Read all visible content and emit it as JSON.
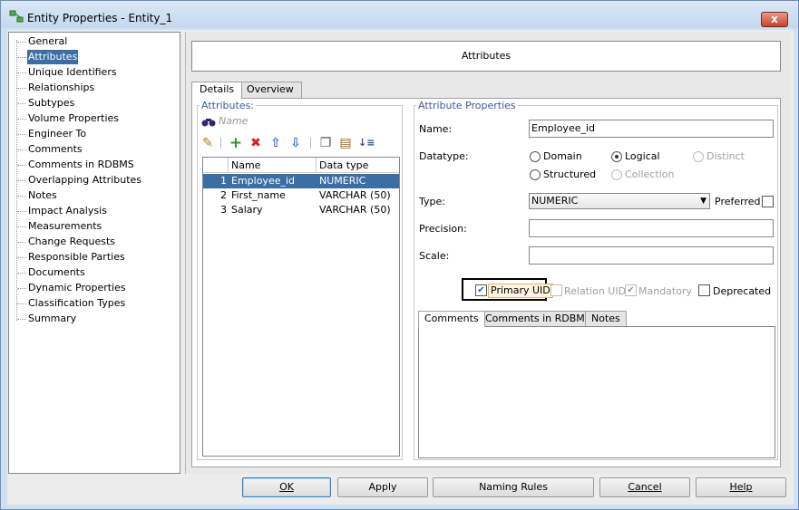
{
  "window": {
    "title": "Entity Properties - Entity_1",
    "close_label": "x"
  },
  "nav": {
    "items": [
      "General",
      "Attributes",
      "Unique Identifiers",
      "Relationships",
      "Subtypes",
      "Volume Properties",
      "Engineer To",
      "Comments",
      "Comments in RDBMS",
      "Overlapping Attributes",
      "Notes",
      "Impact Analysis",
      "Measurements",
      "Change Requests",
      "Responsible Parties",
      "Documents",
      "Dynamic Properties",
      "Classification Types",
      "Summary"
    ],
    "selected": "Attributes"
  },
  "header": {
    "title": "Attributes"
  },
  "tabs": [
    "Details",
    "Overview"
  ],
  "attributes": {
    "label": "Attributes:",
    "search_placeholder": "Name",
    "columns": [
      "Name",
      "Data type"
    ],
    "rows": [
      {
        "num": "1",
        "name": "Employee_id",
        "type": "NUMERIC"
      },
      {
        "num": "2",
        "name": "First_name",
        "type": "VARCHAR (50)"
      },
      {
        "num": "3",
        "name": "Salary",
        "type": "VARCHAR (50)"
      }
    ]
  },
  "props": {
    "label": "Attribute Properties",
    "name_label": "Name:",
    "name_value": "Employee_id",
    "datatype_label": "Datatype:",
    "radio_domain": "Domain",
    "radio_logical": "Logical",
    "radio_distinct": "Distinct",
    "radio_structured": "Structured",
    "radio_collection": "Collection",
    "type_label": "Type:",
    "type_value": "NUMERIC",
    "preferred_label": "Preferred",
    "precision_label": "Precision:",
    "scale_label": "Scale:",
    "primary_uid": "Primary UID",
    "relation_uid": "Relation UID",
    "mandatory": "Mandatory",
    "deprecated": "Deprecated"
  },
  "subtabs": [
    "Comments",
    "Comments in RDBMS",
    "Notes"
  ],
  "buttons": {
    "ok": "OK",
    "apply": "Apply",
    "naming": "Naming Rules",
    "cancel": "Cancel",
    "help": "Help"
  }
}
